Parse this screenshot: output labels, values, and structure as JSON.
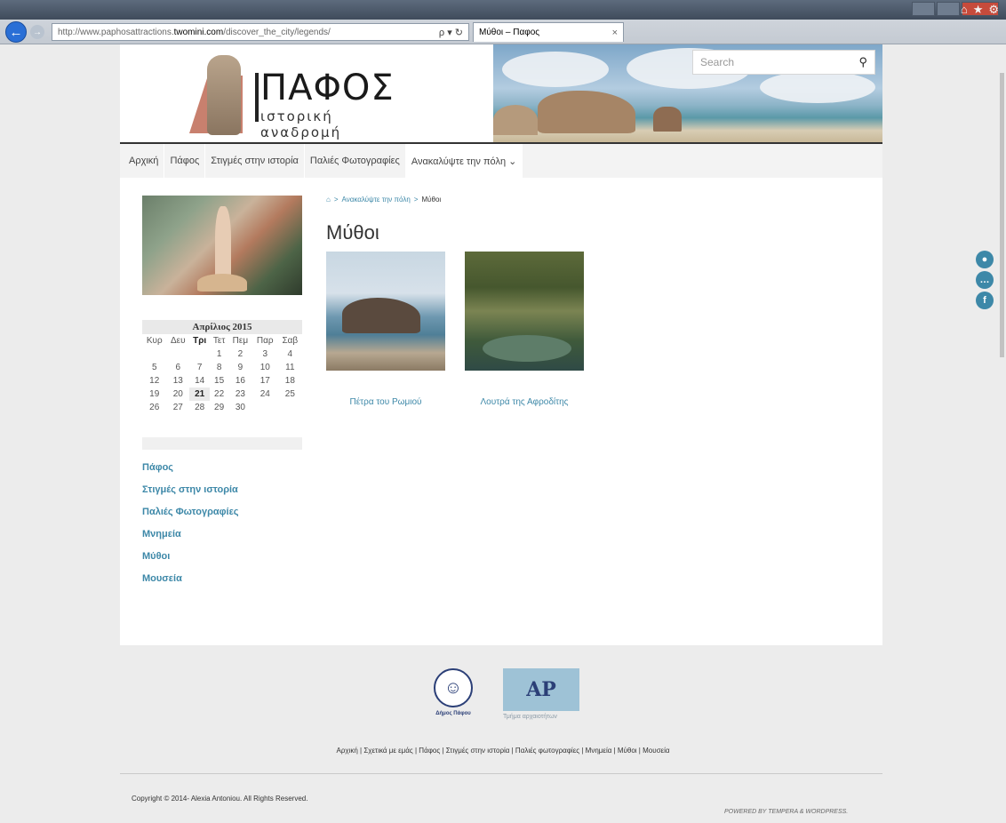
{
  "browser": {
    "url_prefix": "http://www.paphosattractions.",
    "url_domain": "twomini.com",
    "url_path": "/discover_the_city/legends/",
    "address_controls": "ρ ▾ ↻",
    "tab_title": "Μύθοι – Παφος",
    "tab_close": "×",
    "toolbar_icons": [
      "home-icon",
      "star-icon",
      "gear-icon"
    ]
  },
  "header": {
    "logo_title": "ΠΑΦΟΣ",
    "logo_subtitle": "ιστορική αναδρομή",
    "search_placeholder": "Search"
  },
  "menu": {
    "items": [
      "Αρχική",
      "Πάφος",
      "Στιγμές στην ιστορία",
      "Παλιές Φωτογραφίες",
      "Ανακαλύψτε την πόλη ⌄"
    ]
  },
  "calendar": {
    "caption": "Απρίλιος 2015",
    "weekdays": [
      "Κυρ",
      "Δευ",
      "Τρι",
      "Τετ",
      "Πεμ",
      "Παρ",
      "Σαβ"
    ],
    "weeks": [
      [
        "",
        "",
        "",
        "1",
        "2",
        "3",
        "4"
      ],
      [
        "5",
        "6",
        "7",
        "8",
        "9",
        "10",
        "11"
      ],
      [
        "12",
        "13",
        "14",
        "15",
        "16",
        "17",
        "18"
      ],
      [
        "19",
        "20",
        "21",
        "22",
        "23",
        "24",
        "25"
      ],
      [
        "26",
        "27",
        "28",
        "29",
        "30",
        "",
        ""
      ]
    ],
    "today": "21"
  },
  "sidebar_links": [
    "Πάφος",
    "Στιγμές στην ιστορία",
    "Παλιές Φωτογραφίες",
    "Μνημεία",
    "Μύθοι",
    "Μουσεία"
  ],
  "breadcrumb": {
    "home_icon": "home-icon",
    "sep": ">",
    "parent": "Ανακαλύψτε την πόλη",
    "current": "Μύθοι"
  },
  "main": {
    "title": "Μύθοι",
    "items": [
      {
        "caption": "Πέτρα του Ρωμιού",
        "thumb": "rock"
      },
      {
        "caption": "Λουτρά της Αφροδίτης",
        "thumb": "bath"
      }
    ]
  },
  "social_icons": [
    "user-icon",
    "chat-icon",
    "facebook-icon"
  ],
  "footer": {
    "dimos_label": "Δήμος Πάφου",
    "arch_label": "Τμήμα αρχαιοτήτων",
    "links": "Αρχική | Σχετικά με εμάς | Πάφος | Στιγμές στην ιστορία | Παλιές φωτογραφίες | Μνημεία | Μύθοι | Μουσεία",
    "copyright": "Copyright © 2014- Alexia Antoniou. All Rights Reserved.",
    "powered": "POWERED BY TEMPERA & WORDPRESS."
  },
  "colors": {
    "accent": "#3d88a8",
    "logo_shape": "#c8806e",
    "ie_blue": "#2a6fd6"
  }
}
